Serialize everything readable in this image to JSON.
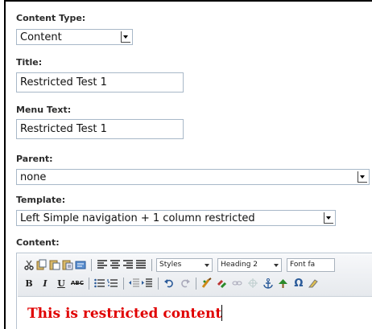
{
  "form": {
    "content_type": {
      "label": "Content Type:",
      "value": "Content"
    },
    "title": {
      "label": "Title:",
      "value": "Restricted Test 1"
    },
    "menu_text": {
      "label": "Menu Text:",
      "value": "Restricted Test 1"
    },
    "parent": {
      "label": "Parent:",
      "value": "none"
    },
    "template": {
      "label": "Template:",
      "value": "Left Simple navigation + 1 column restricted"
    },
    "content": {
      "label": "Content:"
    }
  },
  "editor": {
    "toolbar_row1": {
      "icons": [
        "cut-icon",
        "copy-icon",
        "paste-icon",
        "paste-text-icon",
        "paste-word-icon",
        "align-left-icon",
        "align-center-icon",
        "align-right-icon",
        "align-justify-icon"
      ],
      "styles_value": "Styles",
      "format_value": "Heading 2",
      "font_value": "Font fa"
    },
    "toolbar_row2": {
      "bold": "B",
      "italic": "I",
      "underline": "U",
      "strike": "ABC",
      "icons": [
        "bullet-list-icon",
        "numbered-list-icon",
        "outdent-icon",
        "indent-icon",
        "undo-icon",
        "redo-icon",
        "link-icon",
        "unlink-icon",
        "anchor-icon",
        "image-icon",
        "special-char-icon",
        "cleanup-icon"
      ],
      "special_char": "Ω"
    },
    "content_text": "This is restricted content",
    "content_color": "#e00000"
  }
}
